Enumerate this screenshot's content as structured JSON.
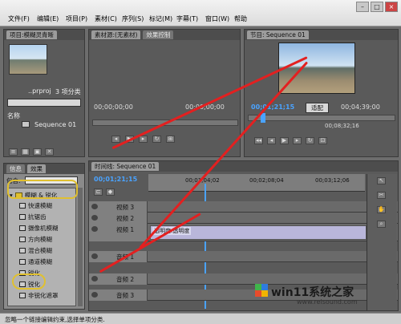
{
  "menubar": {
    "items": [
      "文件(F)",
      "编辑(E)",
      "项目(P)",
      "素材(C)",
      "序列(S)",
      "标记(M)",
      "字幕(T)",
      "窗口(W)",
      "帮助"
    ]
  },
  "project": {
    "tab": "项目:模糊灵青晰",
    "file": "..prproj",
    "count": "3 项分类",
    "name_label": "名称",
    "sequence": "Sequence 01"
  },
  "source": {
    "tabs": [
      "素材源:(无素材)",
      "效果控制"
    ],
    "timecode": "00;00;00;00",
    "timecode2": "00;00;00;00"
  },
  "program": {
    "tab": "节目: Sequence 01",
    "timecode": "00;01;21;15",
    "fit": "适配",
    "duration": "00;04;39;00",
    "ruler_label": "00;08;32;16"
  },
  "effects": {
    "tabs": [
      "信息",
      "效果"
    ],
    "contains_label": "包含:",
    "folder": "模糊 & 锐化",
    "items": [
      "快速模糊",
      "抗锯齿",
      "摄像机模糊",
      "方向模糊",
      "混合模糊",
      "通道模糊",
      "锐化",
      "锐化",
      "非锐化遮罩"
    ]
  },
  "timeline": {
    "tab": "时间线: Sequence 01",
    "timecode": "00;01;21;15",
    "ruler": [
      "00;01;04;02",
      "00;02;08;04",
      "00;03;12;06"
    ],
    "tracks": [
      "视频 3",
      "视频 2",
      "视频 1",
      "音频 1",
      "音频 2",
      "音频 3"
    ],
    "clip_label": "透明度:透明度"
  },
  "status": {
    "text": "忽略一个链接编辑约束,选择单项分类."
  },
  "watermark": {
    "text": "win11系统之家",
    "url": "www.relsound.com"
  },
  "colors": {
    "accent": "#4aa3ff",
    "annotation": "#e32020",
    "highlight": "#e0c030"
  }
}
